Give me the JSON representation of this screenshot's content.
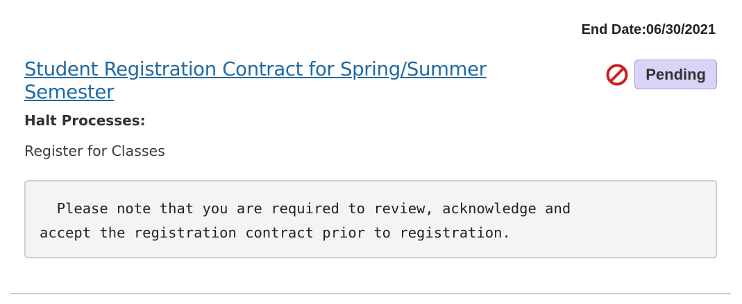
{
  "end_date": {
    "text": "End Date:06/30/2021"
  },
  "hold": {
    "title": "Student Registration Contract for Spring/Summer Semester",
    "status_icon": "block-icon",
    "status_icon_color": "#cc2222",
    "status": "Pending",
    "halt_label": "Halt Processes:",
    "halt_items": [
      "Register for Classes"
    ],
    "message": "  Please note that you are required to review, acknowledge and\naccept the registration contract prior to registration."
  },
  "colors": {
    "link": "#1f6aa5",
    "badge_bg": "#d9d3f7",
    "badge_border": "#a49ad6",
    "message_bg": "#f4f4f4",
    "divider": "#b8cfe0"
  }
}
